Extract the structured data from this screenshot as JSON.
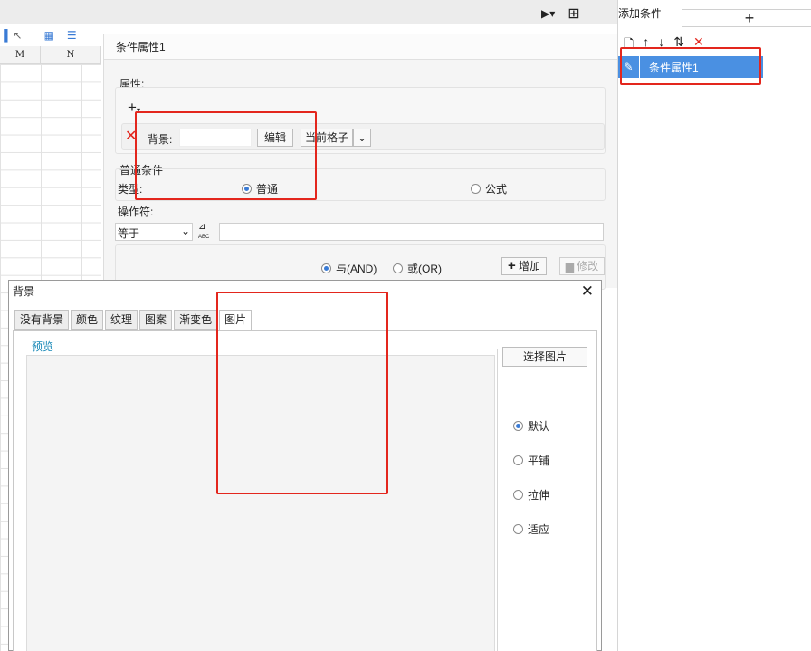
{
  "sheet": {
    "columns": [
      "M",
      "N"
    ]
  },
  "panel": {
    "title": "条件属性1",
    "attributes_label": "属性:",
    "background_label": "背景:",
    "background_value": "",
    "edit_button": "编辑",
    "cell_select": "当前格子",
    "general_condition_label": "普通条件",
    "type_label": "类型:",
    "type_options": [
      "普通",
      "公式"
    ],
    "type_selected": "普通",
    "operator_label": "操作符:",
    "operator_value": "等于",
    "and_label": "与(AND)",
    "or_label": "或(OR)",
    "add_button": "增加",
    "modify_button": "修改"
  },
  "right_panel": {
    "title": "添加条件",
    "add_symbol": "+",
    "items": [
      "条件属性1"
    ]
  },
  "dialog": {
    "title": "背景",
    "tabs": [
      "没有背景",
      "颜色",
      "纹理",
      "图案",
      "渐变色",
      "图片"
    ],
    "active_tab": "图片",
    "preview_label": "预览",
    "choose_image_button": "选择图片",
    "layout_options": [
      "默认",
      "平铺",
      "拉伸",
      "适应"
    ],
    "layout_selected": "默认"
  },
  "colors": {
    "accent": "#4a90e2",
    "annotation_red": "#e3261d",
    "delete_red": "#e3261d",
    "legend_teal": "#1a8ab8"
  }
}
